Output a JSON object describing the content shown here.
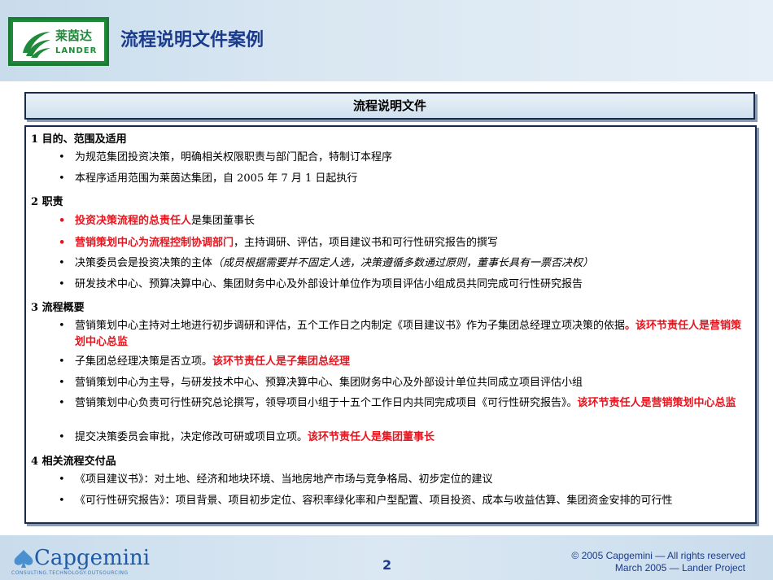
{
  "header": {
    "logo_cn": "莱茵达",
    "logo_en": "LANDER",
    "title": "流程说明文件案例"
  },
  "title_bar": "流程说明文件",
  "sections": {
    "s1": {
      "heading": "1   目的、范围及适用",
      "items": [
        "为规范集团投资决策，明确相关权限职责与部门配合，特制订本程序",
        "本程序适用范围为莱茵达集团，自 2005 年 7 月 1 日起执行"
      ]
    },
    "s2": {
      "heading": "2   职责",
      "i1_red": "投资决策流程的总责任人",
      "i1_rest": "是集团董事长",
      "i2_red": "营销策划中心为流程控制协调部门",
      "i2_rest": "，主持调研、评估，项目建议书和可行性研究报告的撰写",
      "i3_main": "决策委员会是投资决策的主体",
      "i3_ital": "（成员根据需要并不固定人选，决策遵循多数通过原则，董事长具有一票否决权）",
      "i4": "研发技术中心、预算决算中心、集团财务中心及外部设计单位作为项目评估小组成员共同完成可行性研究报告"
    },
    "s3": {
      "heading": "3   流程概要",
      "i1_text": "营销策划中心主持对土地进行初步调研和评估，五个工作日之内制定《项目建议书》作为子集团总经理立项决策的依据",
      "i1_red": "。该环节责任人是营销策划中心总监",
      "i2_text": "子集团总经理决策是否立项。",
      "i2_red": "该环节责任人是子集团总经理",
      "i3": "营销策划中心为主导，与研发技术中心、预算决算中心、集团财务中心及外部设计单位共同成立项目评估小组",
      "i4_text": "营销策划中心负责可行性研究总论撰写，领导项目小组于十五个工作日内共同完成项目《可行性研究报告》。",
      "i4_red": "该环节责任人是营销策划中心总监",
      "i5_text": "提交决策委员会审批，决定修改可研或项目立项。",
      "i5_red": "该环节责任人是集团董事长"
    },
    "s4": {
      "heading": "4   相关流程交付品",
      "items": [
        "《项目建议书》：对土地、经济和地块环境、当地房地产市场与竞争格局、初步定位的建议",
        "《可行性研究报告》：项目背景、项目初步定位、容积率绿化率和户型配置、项目投资、成本与收益估算、集团资金安排的可行性"
      ]
    }
  },
  "footer": {
    "company": "Capgemini",
    "tagline": "CONSULTING.TECHNOLOGY.OUTSOURCING",
    "page_number": "2",
    "copyright": "© 2005 Capgemini —  All rights reserved",
    "project": "March 2005 — Lander Project"
  },
  "colors": {
    "accent_red": "#e8141e",
    "title_blue": "#1a3a8c",
    "logo_green": "#1f8a3a"
  }
}
